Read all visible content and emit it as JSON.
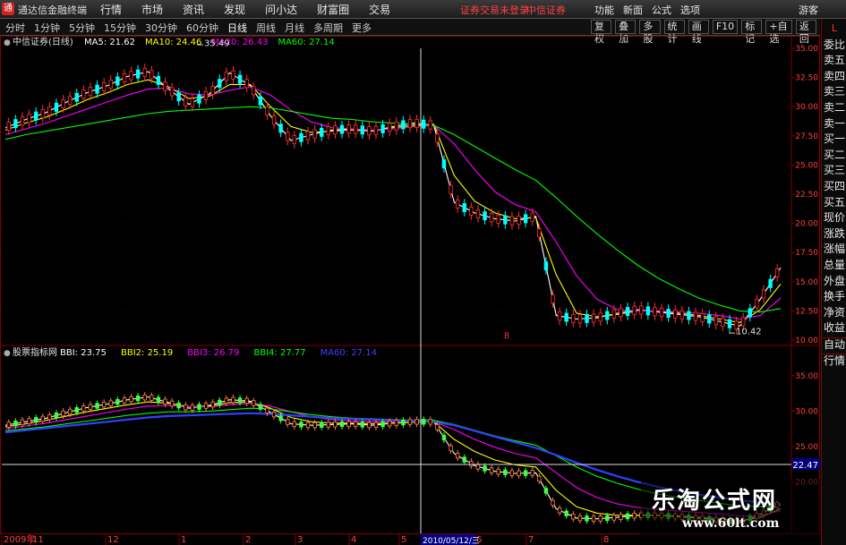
{
  "window": {
    "app_title": "通达信金融终端",
    "warning": "证券交易未登录",
    "broker": "中信证券",
    "guest": "游客"
  },
  "menu": [
    "行情",
    "市场",
    "资讯",
    "发现",
    "问小达",
    "财富圈",
    "交易"
  ],
  "right_menu": [
    "功能",
    "新面",
    "公式",
    "选项"
  ],
  "periods": [
    "分时",
    "1分钟",
    "5分钟",
    "15分钟",
    "30分钟",
    "60分钟",
    "日线",
    "周线",
    "月线",
    "多周期",
    "更多"
  ],
  "active_period": "日线",
  "toolbar_buttons": [
    "复权",
    "叠加",
    "多股",
    "统计",
    "画线",
    "F10",
    "标记",
    "+自选",
    "返回"
  ],
  "sidebar": [
    "L",
    "委比",
    "卖五",
    "卖四",
    "卖三",
    "卖二",
    "卖一",
    "买一",
    "买二",
    "买三",
    "买四",
    "买五",
    "现价",
    "涨跌",
    "涨幅",
    "总量",
    "外盘",
    "换手",
    "净资",
    "收益",
    "自动",
    "行情"
  ],
  "colors": {
    "up": "#ff3030",
    "down": "#00ffff",
    "ma5": "#ffffff",
    "ma10": "#ffff00",
    "ma20": "#ff00ff",
    "ma60": "#00ff00",
    "grid": "#800000"
  },
  "chart_data": [
    {
      "type": "line",
      "title": "中信证券(日线)",
      "legend": [
        {
          "name": "MA5",
          "value": "21.62",
          "color": "#ffffff"
        },
        {
          "name": "MA10",
          "value": "24.46",
          "color": "#ffff00"
        },
        {
          "name": "MA20",
          "value": "26.43",
          "color": "#ff00ff"
        },
        {
          "name": "MA60",
          "value": "27.14",
          "color": "#00ff00"
        }
      ],
      "y_ticks": [
        "35.00",
        "32.50",
        "30.00",
        "27.50",
        "25.00",
        "22.50",
        "20.00",
        "17.50",
        "15.00",
        "12.50",
        "10.00"
      ],
      "ylim": [
        10,
        35
      ],
      "high_label": "35.49",
      "low_label": "10.42",
      "series": [
        {
          "color": "#ffffff",
          "values": [
            28.2,
            28.9,
            29.5,
            30.4,
            31.2,
            31.8,
            32.6,
            33.0,
            31.5,
            30.2,
            31.1,
            32.9,
            31.8,
            29.2,
            27.1,
            27.6,
            28.0,
            28.1,
            27.9,
            28.3,
            28.6,
            28.4,
            21.8,
            20.9,
            20.4,
            20.2,
            20.6,
            12.1,
            11.8,
            11.9,
            12.3,
            12.6,
            12.4,
            12.2,
            12.0,
            11.6,
            11.2,
            13.5,
            16.2
          ]
        },
        {
          "color": "#ffff00",
          "values": [
            28.0,
            28.6,
            29.1,
            29.8,
            30.6,
            31.2,
            31.9,
            32.3,
            31.7,
            30.7,
            30.9,
            31.9,
            31.9,
            30.0,
            28.3,
            27.8,
            27.9,
            28.0,
            27.9,
            28.2,
            28.4,
            28.5,
            24.1,
            21.9,
            20.9,
            20.4,
            20.5,
            15.6,
            12.3,
            12.0,
            12.2,
            12.5,
            12.5,
            12.3,
            12.1,
            11.8,
            11.5,
            12.6,
            14.8
          ]
        },
        {
          "color": "#ff00ff",
          "values": [
            27.6,
            28.1,
            28.6,
            29.2,
            29.8,
            30.4,
            31.0,
            31.5,
            31.6,
            31.1,
            31.0,
            31.4,
            31.7,
            31.0,
            29.7,
            28.7,
            28.2,
            28.1,
            28.0,
            28.1,
            28.3,
            28.4,
            26.8,
            24.6,
            22.7,
            21.6,
            21.0,
            18.4,
            15.5,
            13.5,
            12.6,
            12.5,
            12.5,
            12.4,
            12.3,
            12.1,
            11.8,
            12.1,
            13.6
          ]
        },
        {
          "color": "#00ff00",
          "values": [
            27.2,
            27.6,
            27.9,
            28.2,
            28.5,
            28.8,
            29.1,
            29.4,
            29.6,
            29.7,
            29.8,
            29.9,
            30.0,
            29.9,
            29.6,
            29.3,
            29.0,
            28.9,
            28.7,
            28.6,
            28.5,
            28.4,
            27.6,
            26.6,
            25.6,
            24.6,
            23.7,
            22.2,
            20.6,
            19.1,
            17.7,
            16.4,
            15.3,
            14.4,
            13.6,
            13.0,
            12.5,
            12.4,
            12.7
          ]
        }
      ]
    },
    {
      "type": "line",
      "title": "股票指标网",
      "legend": [
        {
          "name": "BBI",
          "value": "23.75",
          "color": "#ffffff"
        },
        {
          "name": "BBI2",
          "value": "25.19",
          "color": "#ffff00"
        },
        {
          "name": "BBI3",
          "value": "26.79",
          "color": "#ff00ff"
        },
        {
          "name": "BBI4",
          "value": "27.77",
          "color": "#00ff00"
        },
        {
          "name": "MA60",
          "value": "27.14",
          "color": "#4040ff"
        }
      ],
      "y_ticks": [
        "35.00",
        "30.00",
        "25.00",
        "20.00"
      ],
      "ylim": [
        13.5,
        37.5
      ],
      "crosshair_value": "22.47",
      "crosshair_date": "2010/05/12/三",
      "x_ticks": [
        "2009年",
        "11",
        "12",
        "1",
        "2",
        "3",
        "4",
        "5",
        "6",
        "7",
        "8"
      ],
      "series": [
        {
          "color": "#ffffff",
          "values": [
            28.0,
            28.5,
            29.0,
            29.8,
            30.5,
            31.0,
            31.6,
            32.0,
            31.2,
            30.4,
            30.8,
            31.6,
            31.4,
            29.8,
            28.2,
            28.0,
            28.1,
            28.2,
            28.0,
            28.3,
            28.5,
            28.5,
            24.0,
            22.3,
            21.5,
            21.2,
            21.3,
            16.2,
            14.9,
            14.8,
            15.0,
            15.3,
            15.3,
            15.1,
            14.9,
            14.6,
            14.3,
            15.4,
            17.0
          ]
        },
        {
          "color": "#ffff00",
          "values": [
            27.8,
            28.2,
            28.7,
            29.3,
            29.9,
            30.4,
            30.9,
            31.3,
            31.1,
            30.6,
            30.7,
            31.2,
            31.3,
            30.4,
            29.1,
            28.5,
            28.3,
            28.3,
            28.2,
            28.3,
            28.4,
            28.5,
            26.0,
            24.3,
            23.1,
            22.4,
            22.1,
            18.8,
            16.5,
            15.6,
            15.3,
            15.3,
            15.3,
            15.2,
            15.0,
            14.8,
            14.5,
            15.0,
            16.2
          ]
        },
        {
          "color": "#ff00ff",
          "values": [
            27.5,
            27.9,
            28.3,
            28.8,
            29.3,
            29.8,
            30.3,
            30.7,
            30.8,
            30.6,
            30.6,
            30.9,
            31.1,
            30.7,
            29.9,
            29.2,
            28.8,
            28.6,
            28.5,
            28.5,
            28.5,
            28.5,
            27.4,
            26.0,
            24.9,
            24.0,
            23.4,
            21.3,
            19.2,
            17.8,
            16.9,
            16.4,
            16.1,
            15.9,
            15.7,
            15.5,
            15.2,
            15.3,
            15.9
          ]
        },
        {
          "color": "#00ff00",
          "values": [
            27.2,
            27.5,
            27.8,
            28.2,
            28.6,
            29.0,
            29.4,
            29.7,
            29.9,
            29.9,
            30.0,
            30.2,
            30.4,
            30.3,
            29.9,
            29.5,
            29.2,
            29.0,
            28.9,
            28.8,
            28.7,
            28.7,
            28.1,
            27.3,
            26.5,
            25.8,
            25.2,
            23.7,
            22.1,
            20.8,
            19.8,
            19.0,
            18.3,
            17.8,
            17.4,
            17.0,
            16.6,
            16.5,
            16.7
          ]
        },
        {
          "color": "#3040ff",
          "values": [
            27.0,
            27.3,
            27.6,
            27.9,
            28.2,
            28.5,
            28.8,
            29.1,
            29.3,
            29.4,
            29.5,
            29.6,
            29.7,
            29.6,
            29.4,
            29.2,
            29.0,
            28.9,
            28.8,
            28.7,
            28.6,
            28.5,
            28.0,
            27.2,
            26.4,
            25.6,
            24.8,
            23.8,
            22.7,
            21.7,
            20.8,
            20.0,
            19.3,
            18.7,
            18.2,
            17.8,
            17.4,
            17.1,
            16.9
          ]
        }
      ]
    }
  ],
  "watermark": {
    "cn": "乐淘公式网",
    "url": "www.60lt.com"
  }
}
